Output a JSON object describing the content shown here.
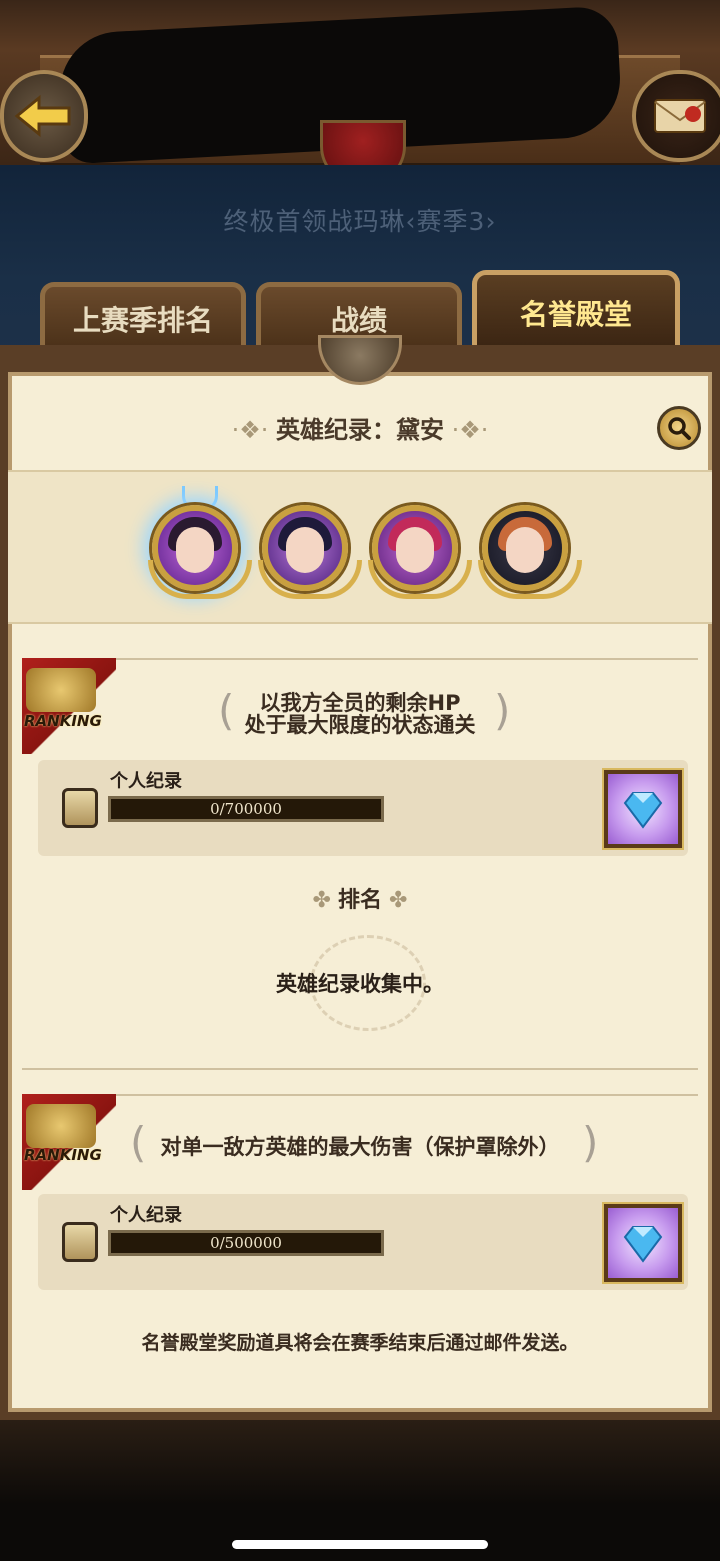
{
  "header": {
    "boss_title": "终极首领战玛琳‹赛季3›"
  },
  "tabs": [
    {
      "label": "上赛季排名"
    },
    {
      "label": "战绩"
    },
    {
      "label": "名誉殿堂"
    }
  ],
  "hero_record": {
    "prefix": "英雄纪录：",
    "hero_name": "黛安"
  },
  "sections": [
    {
      "badge_text": "RANKING",
      "condition_line1": "以我方全员的剩余HP",
      "condition_line2": "处于最大限度的状态通关",
      "record_label": "个人纪录",
      "progress_text": "0/700000"
    },
    {
      "badge_text": "RANKING",
      "condition_line1": "对单一敌方英雄的最大伤害（保护罩除外）",
      "record_label": "个人纪录",
      "progress_text": "0/500000"
    }
  ],
  "ranking": {
    "heading": "排名",
    "status": "英雄纪录收集中。"
  },
  "footer_note": "名誉殿堂奖励道具将会在赛季结束后通过邮件发送。",
  "icons": {
    "back": "back-arrow-icon",
    "mail": "mail-icon",
    "search": "search-icon",
    "scroll": "scroll-icon",
    "gem": "diamond-gem-icon"
  },
  "colors": {
    "active_tab_text": "#ffe890",
    "panel_bg": "#f6eed6",
    "ribbon_red": "#a81c18"
  }
}
